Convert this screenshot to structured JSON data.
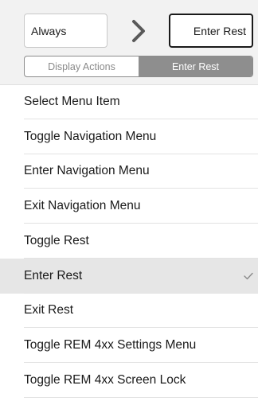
{
  "header": {
    "left_box_label": "Always",
    "right_box_label": "Enter Rest",
    "segmented_control": [
      {
        "label": "Display Actions",
        "active": false
      },
      {
        "label": "Enter Rest",
        "active": true
      }
    ]
  },
  "list": {
    "items": [
      {
        "label": "Select Menu Item",
        "selected": false
      },
      {
        "label": "Toggle Navigation Menu",
        "selected": false
      },
      {
        "label": "Enter Navigation Menu",
        "selected": false
      },
      {
        "label": "Exit Navigation Menu",
        "selected": false
      },
      {
        "label": "Toggle Rest",
        "selected": false
      },
      {
        "label": "Enter Rest",
        "selected": true
      },
      {
        "label": "Exit Rest",
        "selected": false
      },
      {
        "label": "Toggle REM 4xx Settings Menu",
        "selected": false
      },
      {
        "label": "Toggle REM 4xx Screen Lock",
        "selected": false
      }
    ]
  },
  "icons": {
    "arrow": "chevron-right-icon",
    "selected_mark": "checkmark-icon"
  },
  "colors": {
    "header_background": "#f2f2f2",
    "segment_active": "#8e8e8e",
    "selected_row": "#e6e6e6",
    "chevron": "#595959"
  }
}
